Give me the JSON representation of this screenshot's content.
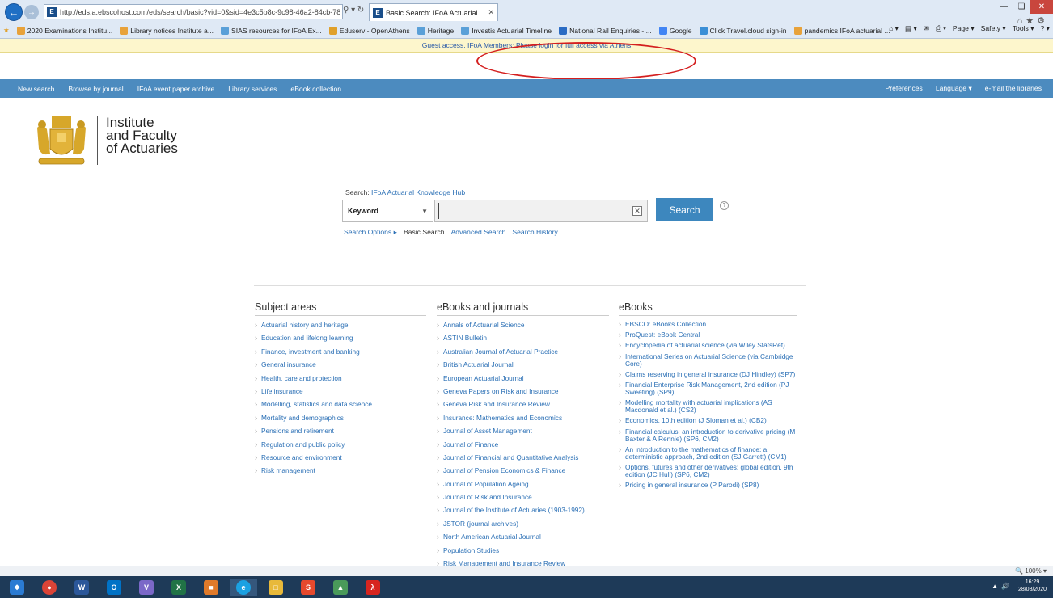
{
  "browser": {
    "address": "http://eds.a.ebscohost.com/eds/search/basic?vid=0&sid=4e3c5b8c-9c98-46a2-84cb-78",
    "tab_title": "Basic Search: IFoA Actuarial...",
    "favorites": [
      "2020 Examinations Institu...",
      "Library notices Institute a...",
      "SIAS resources for IFoA Ex...",
      "Eduserv - OpenAthens",
      "Heritage",
      "Investis Actuarial Timeline",
      "National Rail Enquiries - ...",
      "Google",
      "Click Travel.cloud sign-in",
      "pandemics IFoA actuarial ..."
    ],
    "command_bar": [
      "Page ▾",
      "Safety ▾",
      "Tools ▾"
    ],
    "zoom": "100%",
    "clock_time": "16:29",
    "clock_date": "28/08/2020"
  },
  "banner": {
    "text": "Guest access, IFoA Members: Please login for full access via Athens"
  },
  "site_nav": {
    "left": [
      "New search",
      "Browse by journal",
      "IFoA event paper archive",
      "Library services",
      "eBook collection"
    ],
    "right": [
      "Preferences",
      "Language ▾",
      "e-mail the libraries"
    ]
  },
  "logo": {
    "text": "Institute\nand Faculty\nof Actuaries"
  },
  "search": {
    "label_prefix": "Search:",
    "database": "IFoA Actuarial Knowledge Hub",
    "field": "Keyword",
    "input_value": "",
    "button": "Search",
    "help": "?",
    "links": [
      "Search Options ▸",
      "Basic Search",
      "Advanced Search",
      "Search History"
    ]
  },
  "subject_areas": {
    "heading": "Subject areas",
    "items": [
      "Actuarial history and heritage",
      "Education and lifelong learning",
      "Finance, investment and banking",
      "General insurance",
      "Health, care and protection",
      "Life insurance",
      "Modelling, statistics and data science",
      "Mortality and demographics",
      "Pensions and retirement",
      "Regulation and public policy",
      "Resource and environment",
      "Risk management"
    ]
  },
  "journals": {
    "heading": "eBooks and journals",
    "items": [
      "Annals of Actuarial Science",
      "ASTIN Bulletin",
      "Australian Journal of Actuarial Practice",
      "British Actuarial Journal",
      "European Actuarial Journal",
      "Geneva Papers on Risk and Insurance",
      "Geneva Risk and Insurance Review",
      "Insurance: Mathematics and Economics",
      "Journal of Asset Management",
      "Journal of Finance",
      "Journal of Financial and Quantitative Analysis",
      "Journal of Pension Economics & Finance",
      "Journal of Population Ageing",
      "Journal of Risk and Insurance",
      "Journal of the Institute of Actuaries (1903-1992)",
      "JSTOR (journal archives)",
      "North American Actuarial Journal",
      "Population Studies",
      "Risk Management and Insurance Review"
    ]
  },
  "ebooks": {
    "heading": "eBooks",
    "items": [
      "EBSCO: eBooks Collection",
      "ProQuest: eBook Central",
      "Encyclopedia of actuarial science (via Wiley StatsRef)",
      "International Series on Actuarial Science (via Cambridge Core)",
      "Claims reserving in general insurance (DJ Hindley) (SP7)",
      "Financial Enterprise Risk Management, 2nd edition (PJ Sweeting) (SP9)",
      "Modelling mortality with actuarial implications (AS Macdonald et al.) (CS2)",
      "Economics, 10th edition (J Sloman et al.) (CB2)",
      "Financial calculus: an introduction to derivative pricing (M Baxter & A Rennie) (SP6, CM2)",
      "An introduction to the mathematics of finance: a deterministic approach, 2nd edition (SJ Garrett) (CM1)",
      "Options, futures and other derivatives: global edition, 9th edition (JC Hull) (SP6, CM2)",
      "Pricing in general insurance (P Parodi) (SP8)"
    ]
  },
  "colors": {
    "nav_blue": "#4c8bbf",
    "link_blue": "#2a6fb5",
    "search_button": "#3d87be",
    "annotation_red": "#d41f1f",
    "logo_gold": "#d7a72a"
  }
}
